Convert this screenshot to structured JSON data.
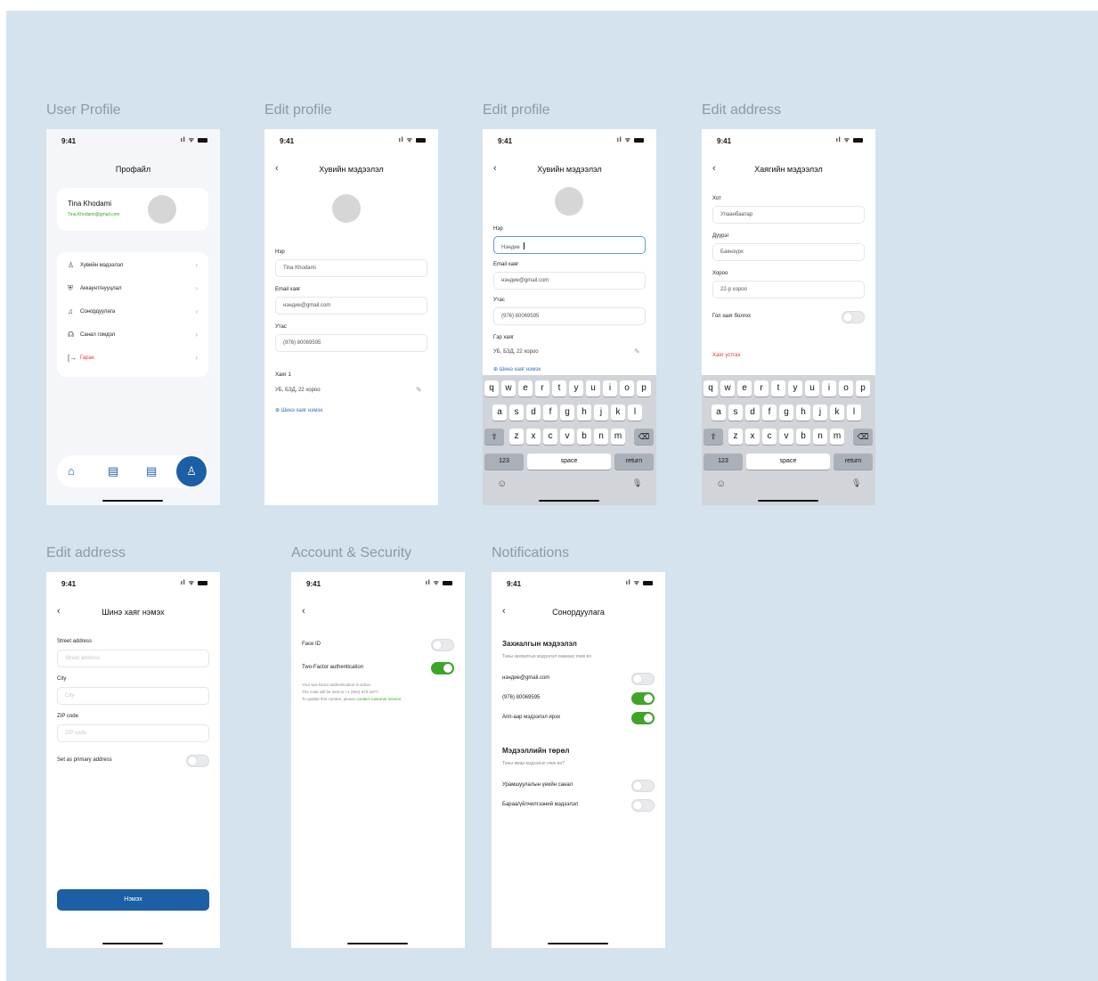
{
  "frames": {
    "user_profile": "User Profile",
    "edit_profile_1": "Edit profile",
    "edit_profile_2": "Edit profile",
    "edit_address_1": "Edit address",
    "edit_address_2": "Edit address",
    "account_security": "Account & Security",
    "notifications": "Notifications"
  },
  "status": {
    "time": "9:41",
    "icons": "ıl ᯤ"
  },
  "profile": {
    "title": "Профайл",
    "name": "Tina Khodami",
    "email": "Tina.Khodami@gmail.com",
    "menu": [
      {
        "icon": "♙",
        "label": "Хувийн мэдээлэл"
      },
      {
        "icon": "⛨",
        "label": "Аккаунт/нууцлал"
      },
      {
        "icon": "♫",
        "label": "Сонордуулага"
      },
      {
        "icon": "☊",
        "label": "Санал гомдол"
      },
      {
        "icon": "[→",
        "label": "Гарах"
      }
    ],
    "chevron": "›"
  },
  "edit1": {
    "title": "Хувийн мэдээлэл",
    "name_label": "Нэр",
    "name_value": "Tina Khodami",
    "email_label": "Email хаяг",
    "email_value": "нэндие@gmail.com",
    "phone_label": "Утас",
    "phone_value": "(976) 80069595",
    "address_label": "Хаяг 1",
    "address_value": "УБ, БЗД, 22 хороо",
    "add_link": "⊕ Шинэ хаяг нэмэх"
  },
  "edit2": {
    "title": "Хувийн мэдээлэл",
    "name_label": "Нэр",
    "name_value": "Нэндие",
    "email_label": "Email хаяг",
    "email_value": "нэндие@gmail.com",
    "phone_label": "Утас",
    "phone_value": "(976) 80069595",
    "address_label": "Гэр хаяг",
    "address_value": "УБ, БЗД, 22 хороо",
    "add_link": "⊕ Шинэ хаяг нэмэх"
  },
  "addr1": {
    "title": "Хаягийн мэдээлэл",
    "city_label": "Хот",
    "city_value": "Улаанбаатар",
    "district_label": "Дүүрэг",
    "district_value": "Баянзүрх",
    "khoroo_label": "Хороо",
    "khoroo_value": "22-р хороо",
    "primary_label": "Гол хаяг болгох",
    "delete_label": "Хаяг устгах"
  },
  "addr2": {
    "title": "Шинэ хаяг нэмэх",
    "street_label": "Street address",
    "street_ph": "Street address",
    "city_label": "City",
    "city_ph": "City",
    "zip_label": "ZIP code",
    "zip_ph": "ZIP code",
    "primary_label": "Set as primary address",
    "button": "Нэмэх"
  },
  "security": {
    "faceid": "Face ID",
    "twofa": "Two-Factor authentication",
    "note1": "Your two-factor authentication is active.",
    "note2": "The code will be sent to +1 (954) 673-1877.",
    "note3": "To update this number, please",
    "note_link": "contact customer service."
  },
  "notif": {
    "title": "Сонордуулага",
    "sec1_title": "Захиалгын мэдээлэл",
    "sec1_sub": "Таны захиалгын мэдээлэл хаанаас очих вэ",
    "row1": "нэндие@gmail.com",
    "row2": "(976) 80069595",
    "row3": "Апп-аар мэдээлэл ирэх",
    "sec2_title": "Мэдээллийн төрөл",
    "sec2_sub": "Таны ямар мэдээлэл очих вэ?",
    "row4": "Урамшуулалын үеийн санал",
    "row5": "Бараа/үйлчилгээний мэдээлэл"
  },
  "keyboard": {
    "row1": [
      "q",
      "w",
      "e",
      "r",
      "t",
      "y",
      "u",
      "i",
      "o",
      "p"
    ],
    "row2": [
      "a",
      "s",
      "d",
      "f",
      "g",
      "h",
      "j",
      "k",
      "l"
    ],
    "row3": [
      "z",
      "x",
      "c",
      "v",
      "b",
      "n",
      "m"
    ],
    "shift": "⇧",
    "backspace": "⌫",
    "num": "123",
    "space": "space",
    "return": "return",
    "emoji": "☺",
    "mic": "🎙"
  },
  "icons": {
    "back": "‹",
    "edit": "✎",
    "home": "⌂",
    "doc": "▤",
    "user": "♙"
  }
}
